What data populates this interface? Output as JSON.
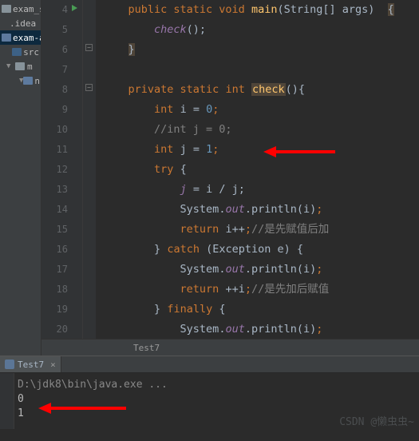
{
  "tree": {
    "root": "exam_syst",
    "idea": ".idea",
    "proj": "exam-a",
    "src": "src",
    "m": "m",
    "n": "n"
  },
  "gutter": [
    "4",
    "5",
    "6",
    "7",
    "8",
    "9",
    "10",
    "11",
    "12",
    "13",
    "14",
    "15",
    "16",
    "17",
    "18",
    "19",
    "20"
  ],
  "code": {
    "l4": {
      "kw1": "public static void",
      "fn": "main",
      "args": "(String[] args)"
    },
    "l5": {
      "call": "check",
      "par": "();"
    },
    "l8": {
      "kw1": "private static",
      "kw2": "int",
      "fn": "check",
      "par": "(){"
    },
    "l9": {
      "kw": "int",
      "var": "i =",
      "val": "0"
    },
    "l10": {
      "cm": "//int j = 0;"
    },
    "l11": {
      "kw": "int",
      "var": "j =",
      "val": "1"
    },
    "l12": {
      "kw": "try"
    },
    "l13": {
      "lhs": "j",
      "op": "= i / j;"
    },
    "l14": {
      "cls": "System.",
      "fld": "out",
      "call": ".println(i)"
    },
    "l15": {
      "kw": "return",
      "expr": "i++",
      "cm": "//是先赋值后加"
    },
    "l16": {
      "kw": "catch",
      "arg": "(Exception e)"
    },
    "l17": {
      "cls": "System.",
      "fld": "out",
      "call": ".println(i)"
    },
    "l18": {
      "kw": "return",
      "expr": "++i",
      "cm": "//是先加后赋值"
    },
    "l19": {
      "kw": "finally"
    },
    "l20": {
      "cls": "System.",
      "fld": "out",
      "call": ".println(i)"
    }
  },
  "breadcrumb": "Test7",
  "tab": {
    "label": "Test7",
    "close": "×"
  },
  "console": {
    "cmd": "D:\\jdk8\\bin\\java.exe ...",
    "out1": "0",
    "out2": "1"
  },
  "watermark": "CSDN @懒虫虫~"
}
